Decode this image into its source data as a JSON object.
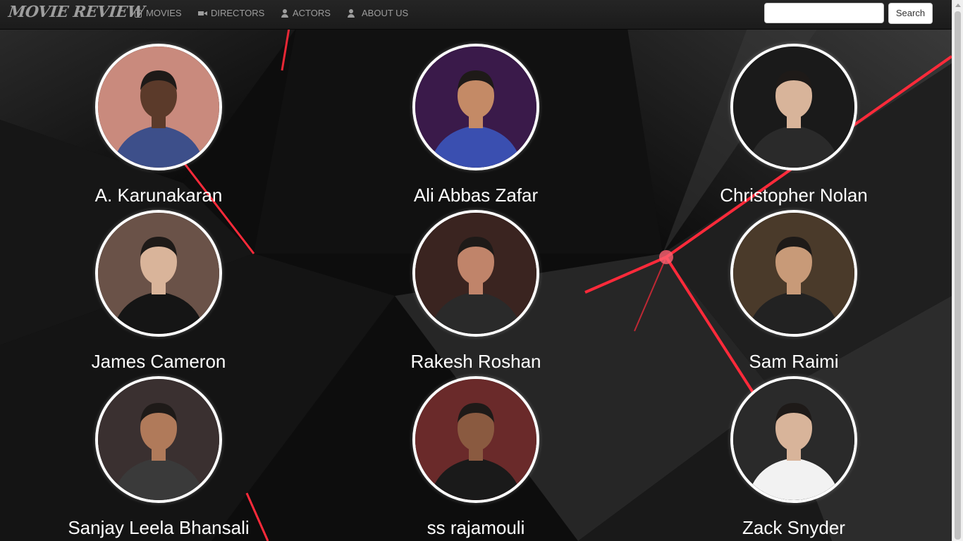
{
  "brand": "MOVIE REVIEW",
  "nav": [
    {
      "label": "MOVIES",
      "icon": "film-icon"
    },
    {
      "label": "DIRECTORS",
      "icon": "video-camera-icon"
    },
    {
      "label": "ACTORS",
      "icon": "user-icon"
    },
    {
      "label": "ABOUT US",
      "icon": "user-icon"
    }
  ],
  "search": {
    "value": "",
    "placeholder": "",
    "button_label": "Search"
  },
  "directors": [
    {
      "name": "A. Karunakaran",
      "photo_bg": "#c98a7d",
      "skin": "#5b3a2a",
      "shirt": "#3d4f8a"
    },
    {
      "name": "Ali Abbas Zafar",
      "photo_bg": "#3a1a4a",
      "skin": "#c48a66",
      "shirt": "#3a4fb0"
    },
    {
      "name": "Christopher Nolan",
      "photo_bg": "#1a1a1a",
      "skin": "#d8b49a",
      "shirt": "#2a2a2a"
    },
    {
      "name": "James Cameron",
      "photo_bg": "#6a5248",
      "skin": "#d9b49a",
      "shirt": "#151515"
    },
    {
      "name": "Rakesh Roshan",
      "photo_bg": "#3a2420",
      "skin": "#c0846a",
      "shirt": "#2a2a2a"
    },
    {
      "name": "Sam Raimi",
      "photo_bg": "#4a3a2a",
      "skin": "#c89a78",
      "shirt": "#222222"
    },
    {
      "name": "Sanjay Leela Bhansali",
      "photo_bg": "#3a3030",
      "skin": "#b07a5a",
      "shirt": "#3a3a3a"
    },
    {
      "name": "ss rajamouli",
      "photo_bg": "#6a2a2a",
      "skin": "#8a5a40",
      "shirt": "#1a1a1a"
    },
    {
      "name": "Zack Snyder",
      "photo_bg": "#2a2a2a",
      "skin": "#d8b49a",
      "shirt": "#f2f2f2"
    }
  ]
}
